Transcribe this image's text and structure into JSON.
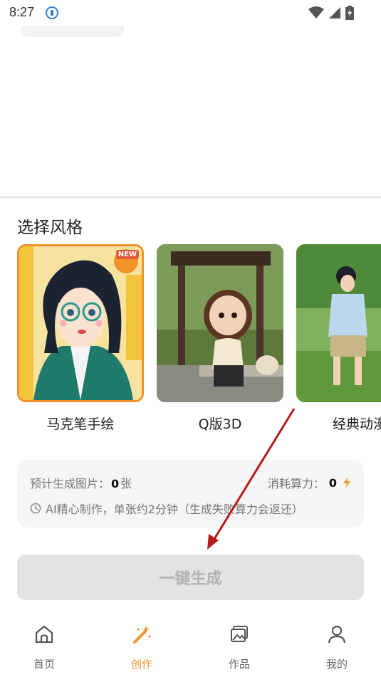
{
  "status_bar": {
    "time": "8:27"
  },
  "style_section": {
    "title": "选择风格",
    "items": [
      {
        "label": "马克笔手绘",
        "selected": true,
        "badge": "NEW"
      },
      {
        "label": "Q版3D",
        "selected": false
      },
      {
        "label": "经典动漫",
        "selected": false
      }
    ]
  },
  "estimate": {
    "images_label": "预计生成图片：",
    "images_value": "0",
    "images_unit": "张",
    "cost_label": "消耗算力：",
    "cost_value": "0",
    "note": "AI精心制作，单张约2分钟（生成失败算力会返还）"
  },
  "generate_button": {
    "label": "一键生成"
  },
  "bottom_nav": {
    "items": [
      {
        "label": "首页",
        "icon": "home-icon",
        "active": false
      },
      {
        "label": "创作",
        "icon": "magic-wand-icon",
        "active": true
      },
      {
        "label": "作品",
        "icon": "gallery-icon",
        "active": false
      },
      {
        "label": "我的",
        "icon": "user-icon",
        "active": false
      }
    ]
  },
  "colors": {
    "accent": "#f2922a",
    "disabled_button": "#e3e3e3",
    "annotation_arrow": "#b31b1b"
  }
}
